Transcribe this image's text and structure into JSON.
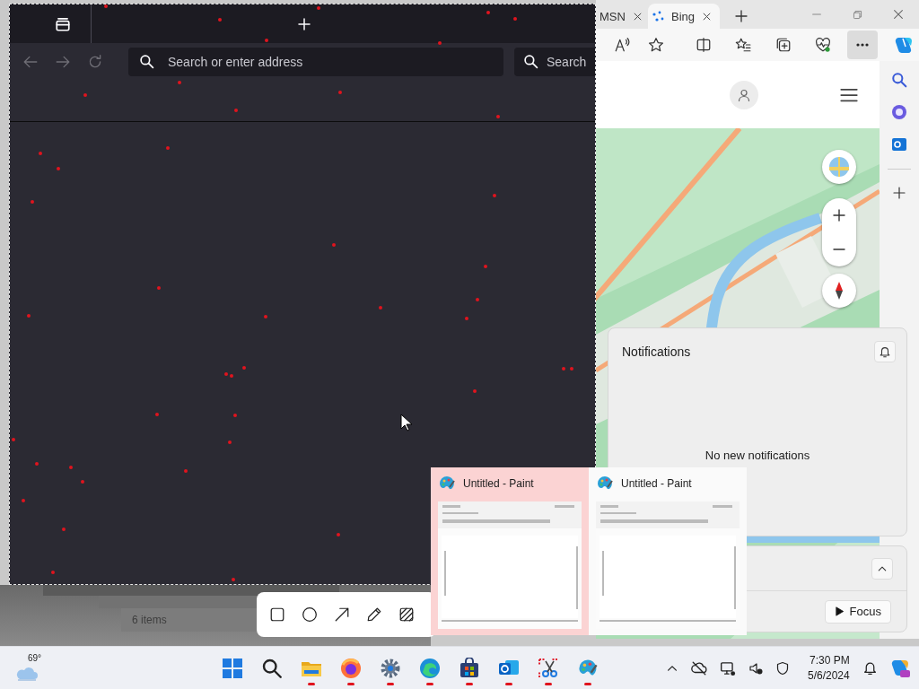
{
  "firefox_window": {
    "address_placeholder": "Search or enter address",
    "search_placeholder": "Search"
  },
  "edge_window": {
    "tabs": [
      {
        "label": "MSN",
        "selected": false
      },
      {
        "label": "Bing",
        "selected": true
      }
    ]
  },
  "notifications": {
    "title": "Notifications",
    "message": "No new notifications"
  },
  "focus_panel": {
    "button": "Focus"
  },
  "explorer_window": {
    "status": "6 items"
  },
  "snip_toolbar": {
    "tools": [
      {
        "kind": "rectangle"
      },
      {
        "kind": "ellipse"
      },
      {
        "kind": "arrow"
      },
      {
        "kind": "pen"
      },
      {
        "kind": "hatch"
      }
    ]
  },
  "taskbar_previews": [
    {
      "title": "Untitled - Paint",
      "selected": true
    },
    {
      "title": "Untitled - Paint",
      "selected": false
    }
  ],
  "taskbar": {
    "weather": "69°",
    "apps": [
      {
        "kind": "start",
        "running": false
      },
      {
        "kind": "search",
        "running": false
      },
      {
        "kind": "folder",
        "running": true
      },
      {
        "kind": "firefox",
        "running": true
      },
      {
        "kind": "settings",
        "running": true
      },
      {
        "kind": "edge",
        "running": true
      },
      {
        "kind": "store",
        "running": true
      },
      {
        "kind": "outlook",
        "running": true
      },
      {
        "kind": "snipping",
        "running": true
      },
      {
        "kind": "paint",
        "running": true
      }
    ],
    "time": "7:30 PM",
    "date": "5/6/2024"
  }
}
